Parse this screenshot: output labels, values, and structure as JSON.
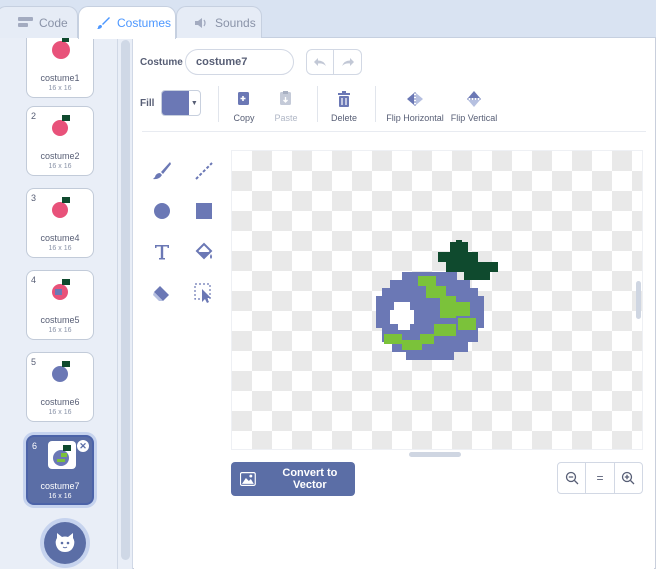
{
  "tabs": {
    "code": "Code",
    "costumes": "Costumes",
    "sounds": "Sounds"
  },
  "costumes": [
    {
      "number": "",
      "name": "costume1",
      "size": "16 x 16",
      "color": "#e8527a"
    },
    {
      "number": "2",
      "name": "costume2",
      "size": "16 x 16",
      "color": "#e8527a"
    },
    {
      "number": "3",
      "name": "costume4",
      "size": "16 x 16",
      "color": "#e8527a"
    },
    {
      "number": "4",
      "name": "costume5",
      "size": "16 x 16",
      "color": "#e8527a"
    },
    {
      "number": "5",
      "name": "costume6",
      "size": "16 x 16",
      "color": "#6b78b5"
    },
    {
      "number": "6",
      "name": "costume7",
      "size": "16 x 16",
      "color": "#6b78b5"
    }
  ],
  "editor": {
    "costume_label": "Costume",
    "costume_name": "costume7",
    "fill_label": "Fill",
    "fill_color": "#6b78b5",
    "copy_label": "Copy",
    "paste_label": "Paste",
    "delete_label": "Delete",
    "flip_horizontal_label": "Flip Horizontal",
    "flip_vertical_label": "Flip Vertical",
    "convert_label": "Convert to Vector",
    "zoom_reset_label": "="
  },
  "colors": {
    "accent": "#4c97ff",
    "primary": "#5b6ea6",
    "sprite_body": "#6b78b5",
    "sprite_patch": "#7bc23a",
    "sprite_leaf": "#0f4a2e"
  }
}
